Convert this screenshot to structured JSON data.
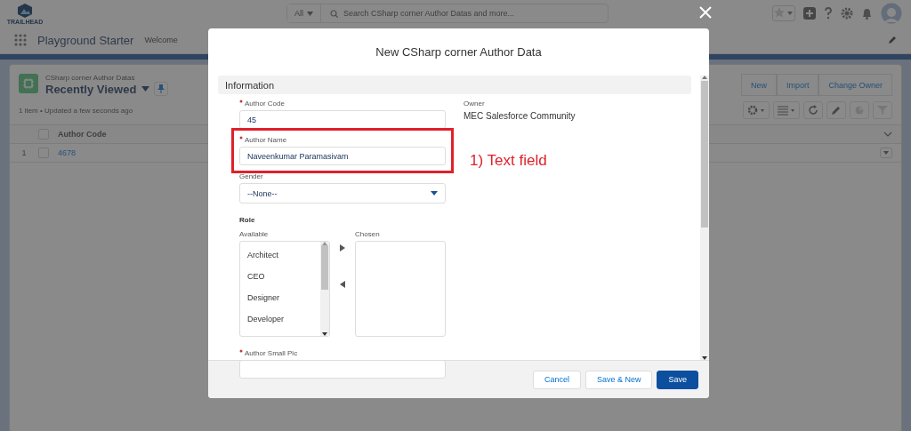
{
  "header": {
    "logo_text": "TRAILHEAD",
    "search_scope": "All",
    "search_placeholder": "Search CSharp corner Author Datas and more..."
  },
  "nav": {
    "app_name": "Playground Starter",
    "items": [
      "Welcome"
    ]
  },
  "list_view": {
    "object_label": "CSharp corner Author Datas",
    "title": "Recently Viewed",
    "status": "1 item • Updated a few seconds ago",
    "actions": [
      "New",
      "Import",
      "Change Owner"
    ],
    "columns": [
      "Author Code"
    ],
    "select_all_checked": false,
    "rows": [
      {
        "number": "1",
        "author_code": "4678",
        "checked": false
      }
    ]
  },
  "modal": {
    "title": "New CSharp corner Author Data",
    "section": "Information",
    "fields": [
      {
        "kind": "text",
        "label": "Author Code",
        "required": true,
        "value": "45",
        "highlighted": false
      },
      {
        "kind": "text",
        "label": "Author Name",
        "required": true,
        "value": "Naveenkumar Paramasivam",
        "highlighted": true
      },
      {
        "kind": "select",
        "label": "Gender",
        "required": false,
        "value": "--None--",
        "highlighted": false
      },
      {
        "kind": "dual_list",
        "label": "Role",
        "available_label": "Available",
        "chosen_label": "Chosen",
        "available": [
          "Architect",
          "CEO",
          "Designer",
          "Developer"
        ],
        "highlighted": false
      },
      {
        "kind": "text",
        "label": "Author Small Pic",
        "required": true,
        "highlighted": false
      }
    ],
    "owner": {
      "label": "Owner",
      "value": "MEC Salesforce Community"
    },
    "buttons": [
      {
        "label": "Cancel",
        "kind": "neutral"
      },
      {
        "label": "Save & New",
        "kind": "neutral"
      },
      {
        "label": "Save",
        "kind": "brand"
      }
    ]
  },
  "annotation": {
    "label": "1) Text field"
  }
}
